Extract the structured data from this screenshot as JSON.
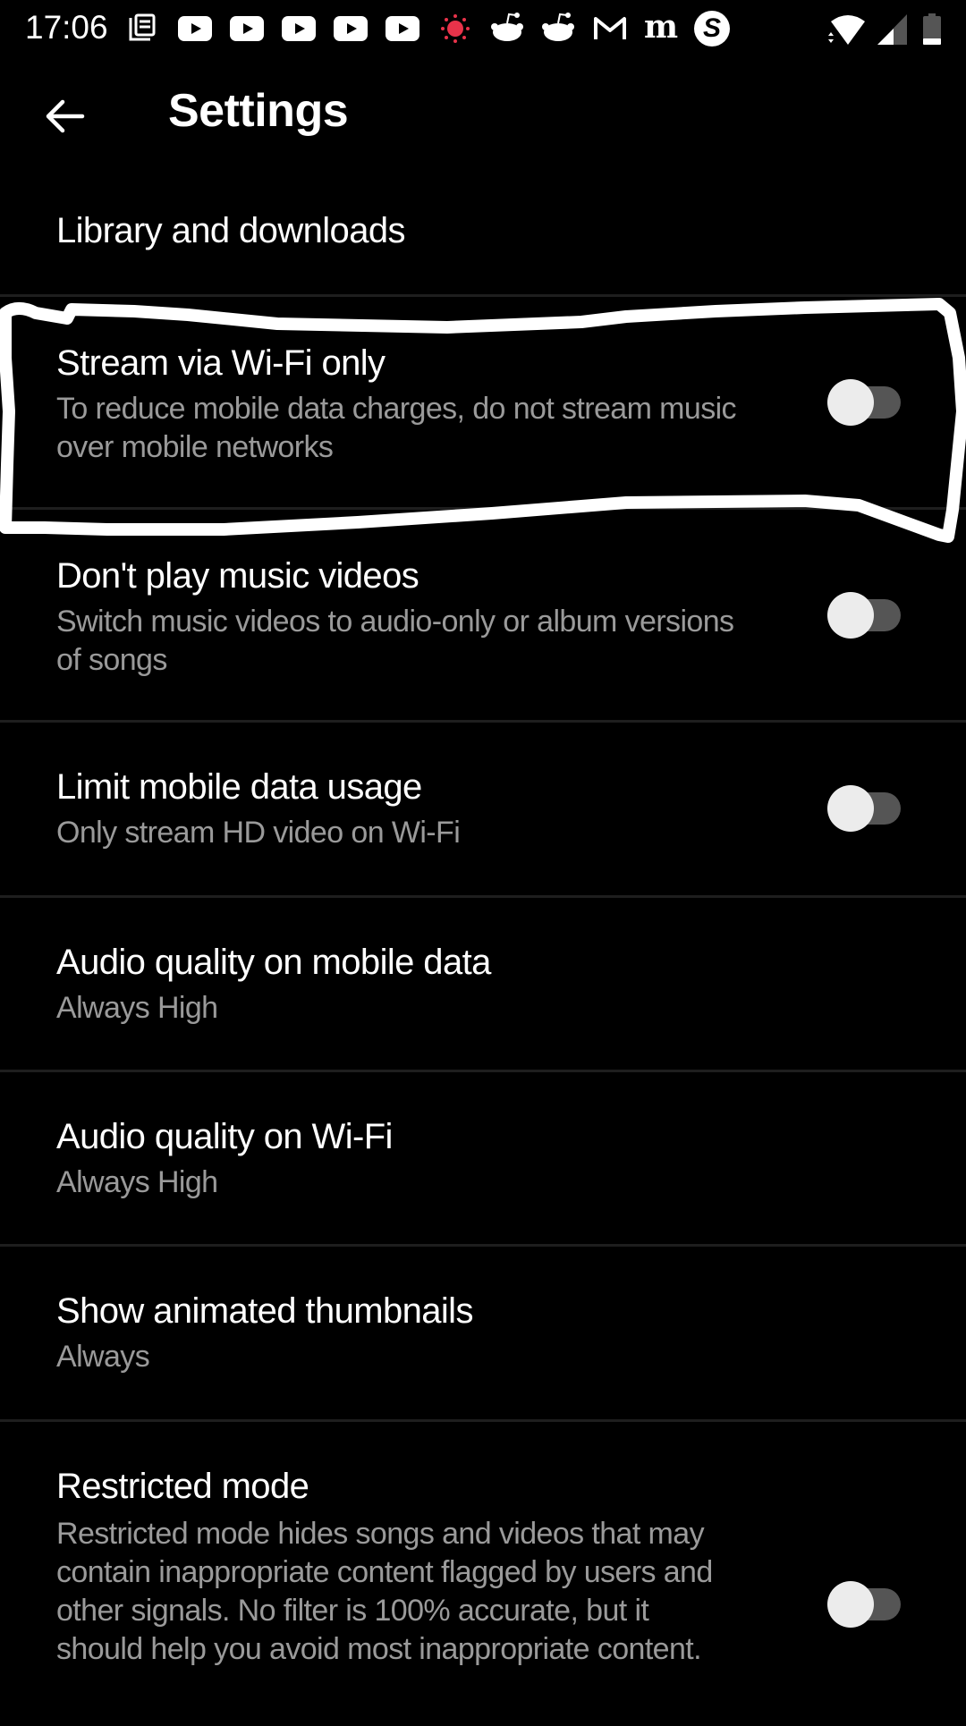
{
  "status_bar": {
    "time": "17:06",
    "notification_icons": [
      "news-icon",
      "youtube-icon",
      "youtube-icon",
      "youtube-icon",
      "youtube-icon",
      "youtube-icon",
      "weather-sun-icon",
      "reddit-icon",
      "reddit-icon",
      "gmail-icon",
      "merriam-webster-icon",
      "s-app-icon"
    ],
    "system_icons": [
      "wifi-icon",
      "cellular-signal-icon",
      "battery-icon"
    ],
    "accent_colors": {
      "sun_icon": "#e8334a"
    }
  },
  "app_bar": {
    "back_icon": "arrow-left-icon",
    "title": "Settings"
  },
  "settings": {
    "items": [
      {
        "label": "Library and downloads"
      },
      {
        "label": "Stream via Wi-Fi only",
        "sub": "To reduce mobile data charges, do not stream music over mobile networks",
        "toggle": false,
        "highlighted": true
      },
      {
        "label": "Don't play music videos",
        "sub": "Switch music videos to audio-only or album versions of songs",
        "toggle": false
      },
      {
        "label": "Limit mobile data usage",
        "sub": "Only stream HD video on Wi-Fi",
        "toggle": false
      },
      {
        "label": "Audio quality on mobile data",
        "sub": "Always High"
      },
      {
        "label": "Audio quality on Wi-Fi",
        "sub": "Always High"
      },
      {
        "label": "Show animated thumbnails",
        "sub": "Always"
      },
      {
        "label": "Restricted mode",
        "sub": "Restricted mode hides songs and videos that may contain inappropriate content flagged by users and other signals. No filter is 100% accurate, but it should help you avoid most inappropriate content.",
        "toggle": false
      }
    ]
  },
  "theme": {
    "background": "#000000",
    "primary_text": "#ffffff",
    "secondary_text": "#9a9a9a",
    "divider": "#1e1e1e",
    "toggle_thumb": "#ececec",
    "toggle_track": "#555555",
    "annotation_stroke": "#ffffff"
  }
}
